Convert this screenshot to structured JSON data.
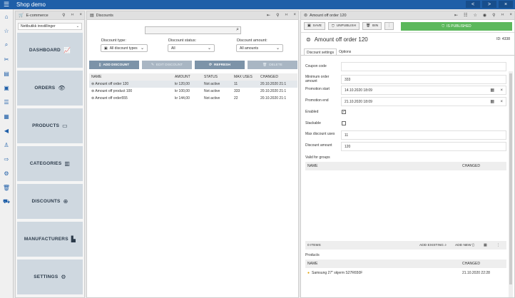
{
  "app": {
    "title": "Shop demo"
  },
  "topbar_buttons": [
    "<",
    ">",
    "×"
  ],
  "sidebar_icons": [
    "home-icon",
    "star-icon",
    "search-icon",
    "tools-icon",
    "receipt-icon",
    "box-icon",
    "list-icon",
    "grid-icon",
    "megaphone-icon",
    "stamp-icon",
    "truck-icon",
    "gear-icon",
    "trash-icon",
    "cart-icon"
  ],
  "ecommerce": {
    "title": "E-commerce",
    "store_select": "Nettbutikk innstillinger",
    "tiles": [
      {
        "label": "DASHBOARD",
        "icon": "📈"
      },
      {
        "label": "ORDERS",
        "icon": "👁"
      },
      {
        "label": "PRODUCTS",
        "icon": "🛒"
      },
      {
        "label": "CATEGORIES",
        "icon": "📊"
      },
      {
        "label": "DISCOUNTS",
        "icon": "⊕"
      },
      {
        "label": "MANUFACTURERS",
        "icon": "🏭"
      },
      {
        "label": "SETTINGS",
        "icon": "⚙"
      }
    ]
  },
  "discounts": {
    "title": "Discounts",
    "type_label": "Discount type:",
    "type_value": "All discount types",
    "status_label": "Discount status:",
    "status_value": "All",
    "amount_label": "Discount amount:",
    "amount_value": "All amounts",
    "buttons": {
      "add": "ADD DISCOUNT",
      "edit": "EDIT DISCOUNT",
      "refresh": "REFRESH",
      "delete": "DELETE"
    },
    "columns": [
      "NAME",
      "AMOUNT",
      "STATUS",
      "MAX USES",
      "CHANGED"
    ],
    "rows": [
      [
        "Amount off order 120",
        "kr 120,00",
        "Not active",
        "11",
        "20.10.2020 21:1"
      ],
      [
        "Amount off product 100",
        "kr 100,00",
        "Not active",
        "333",
        "20.10.2020 21:1"
      ],
      [
        "Amount off order555",
        "kr 144,00",
        "Not active",
        "22",
        "20.10.2020 21:1"
      ]
    ]
  },
  "detail": {
    "header": "Amount off order 120",
    "save": "SAVE",
    "unpublish": "UNPUBLISH",
    "bin": "BIN",
    "published": "IS PUBLISHED",
    "title": "Amount off order 120",
    "id": "ID: 4338",
    "tabs": [
      "Discount settings",
      "Options"
    ],
    "fields": {
      "coupon_code_label": "Coupon code",
      "coupon_code": "",
      "min_amount_label": "Minimum order amount",
      "min_amount": "333",
      "start_label": "Promotion start",
      "start": "14.10.2020 18:09",
      "end_label": "Promotion end",
      "end": "21.10.2020 18:09",
      "enabled_label": "Enabled",
      "stackable_label": "Stackable",
      "max_uses_label": "Max discount uses",
      "max_uses": "11",
      "amount_label": "Discount amount",
      "amount": "120"
    },
    "groups": {
      "title": "Valid for groups",
      "col_name": "NAME",
      "col_changed": "CHANGED",
      "items": "0 ITEMS",
      "add_existing": "ADD EXISTING",
      "add_new": "ADD NEW"
    },
    "products": {
      "title": "Products",
      "col_name": "NAME",
      "col_changed": "CHANGED",
      "row_name": "Samsung 27\" skjerm S27R650F",
      "row_changed": "21.10.2020 22:28"
    }
  }
}
